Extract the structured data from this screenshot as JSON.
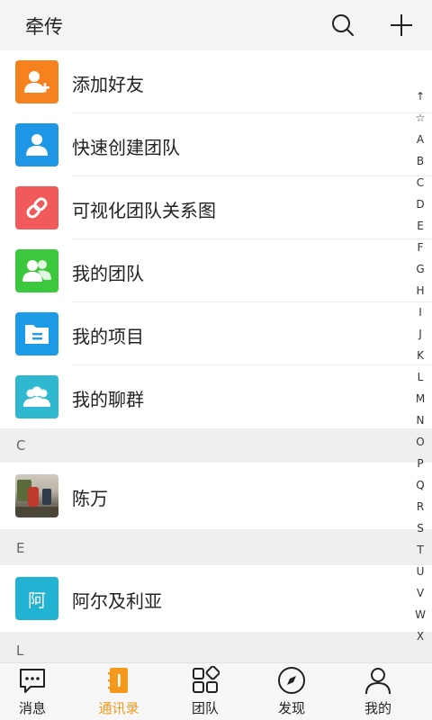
{
  "header": {
    "title": "牵传",
    "search_icon": "search-icon",
    "add_icon": "plus-icon"
  },
  "actions": [
    {
      "label": "添加好友",
      "icon": "add-friend-icon",
      "color": "#f5821f"
    },
    {
      "label": "快速创建团队",
      "icon": "user-icon",
      "color": "#1e96e6"
    },
    {
      "label": "可视化团队关系图",
      "icon": "link-icon",
      "color": "#f05a5a"
    },
    {
      "label": "我的团队",
      "icon": "team-icon",
      "color": "#3cc83c"
    },
    {
      "label": "我的项目",
      "icon": "folder-icon",
      "color": "#1e9be6"
    },
    {
      "label": "我的聊群",
      "icon": "group-chat-icon",
      "color": "#2fb8d0"
    }
  ],
  "sections": [
    {
      "letter": "C",
      "contacts": [
        {
          "name": "陈万",
          "avatar": "photo"
        }
      ]
    },
    {
      "letter": "E",
      "contacts": [
        {
          "name": "阿尔及利亚",
          "avatar_text": "阿",
          "avatar_color": "#22b3d2"
        }
      ]
    },
    {
      "letter": "L",
      "contacts": []
    }
  ],
  "index_bar": [
    "↑",
    "☆",
    "A",
    "B",
    "C",
    "D",
    "E",
    "F",
    "G",
    "H",
    "I",
    "J",
    "K",
    "L",
    "M",
    "N",
    "O",
    "P",
    "Q",
    "R",
    "S",
    "T",
    "U",
    "V",
    "W",
    "X"
  ],
  "tabs": [
    {
      "label": "消息",
      "icon": "chat-bubble-icon",
      "active": false
    },
    {
      "label": "通讯录",
      "icon": "contacts-book-icon",
      "active": true
    },
    {
      "label": "团队",
      "icon": "grid-icon",
      "active": false
    },
    {
      "label": "发现",
      "icon": "compass-icon",
      "active": false
    },
    {
      "label": "我的",
      "icon": "person-icon",
      "active": false
    }
  ],
  "colors": {
    "accent": "#f39a1c"
  }
}
